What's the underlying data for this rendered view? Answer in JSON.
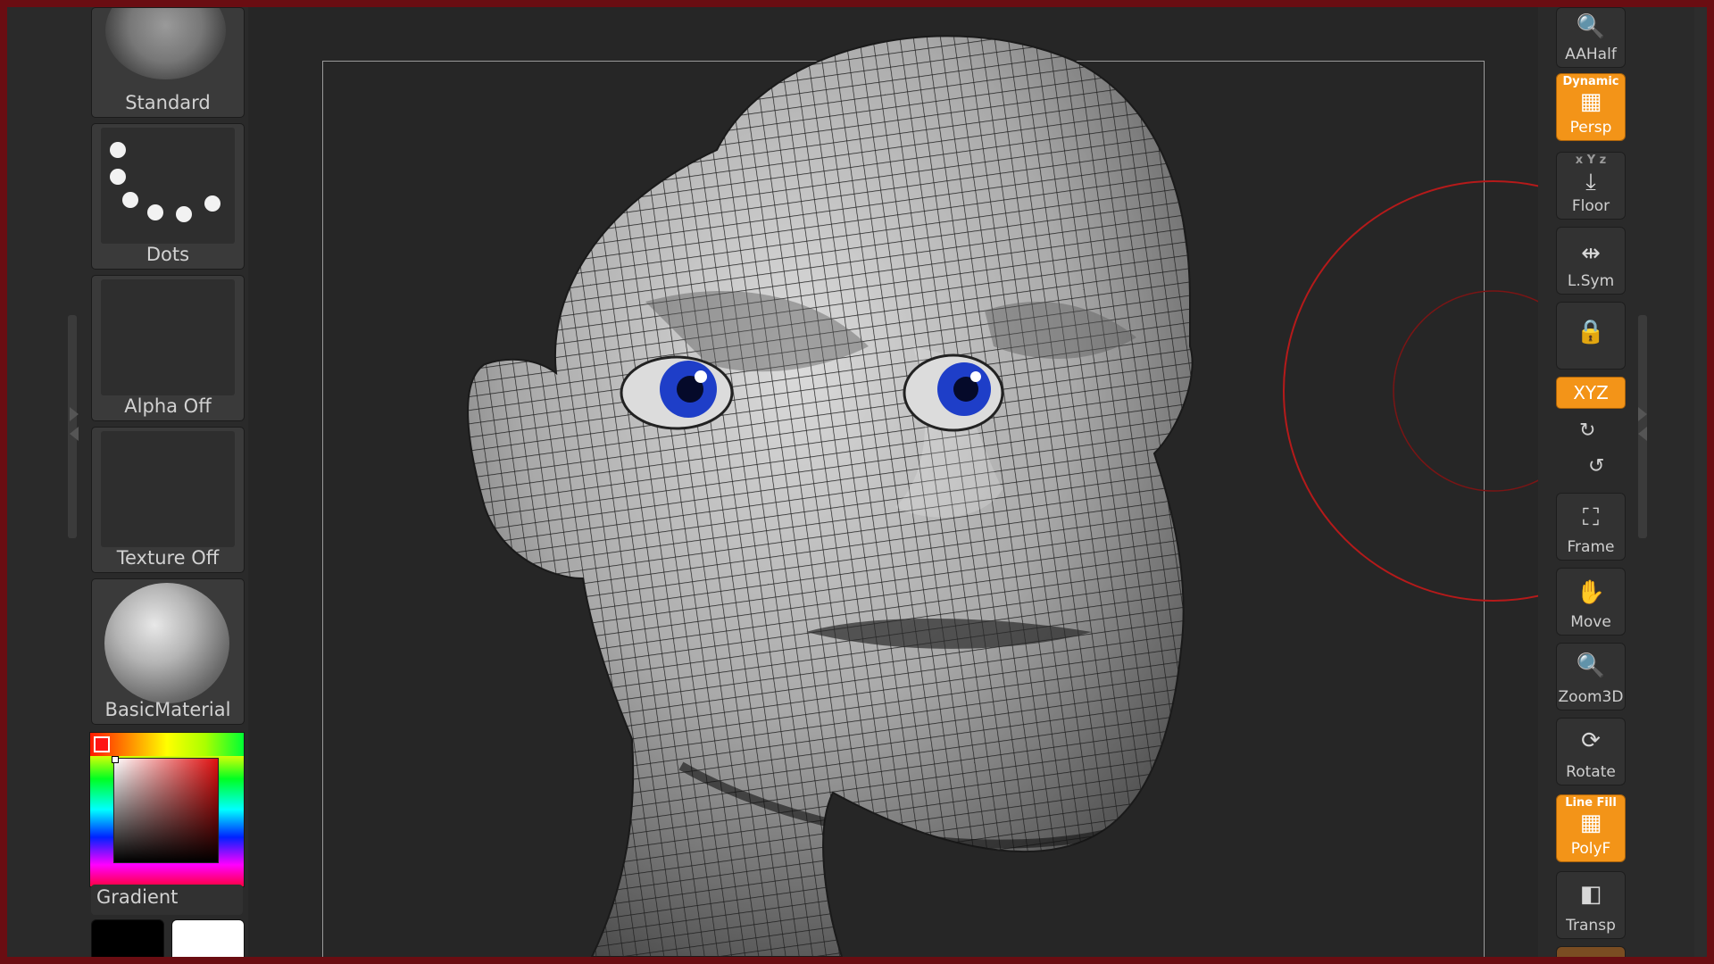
{
  "left_shelf": {
    "brush": {
      "label": "Standard"
    },
    "stroke": {
      "label": "Dots"
    },
    "alpha": {
      "label": "Alpha Off"
    },
    "texture": {
      "label": "Texture Off"
    },
    "material": {
      "label": "BasicMaterial"
    },
    "color": {
      "primary": "#ff1414",
      "gradient_label": "Gradient",
      "main_swatch": "#000000",
      "secondary_swatch": "#ffffff"
    }
  },
  "right_shelf": {
    "buttons": [
      {
        "label": "AAHalf",
        "icon": "magnifier-icon",
        "active": false
      },
      {
        "label": "Persp",
        "tag": "Dynamic",
        "icon": "perspective-grid-icon",
        "active": true
      },
      {
        "label": "Floor",
        "tag": "x Y z",
        "icon": "floor-icon",
        "active": false
      },
      {
        "label": "L.Sym",
        "icon": "local-symmetry-icon",
        "active": false
      },
      {
        "label": "",
        "icon": "lock-camera-icon",
        "active": false
      },
      {
        "label": "XYZ",
        "icon": "rotate-xyz-icon",
        "active": true
      },
      {
        "label": "Frame",
        "icon": "frame-icon",
        "active": false
      },
      {
        "label": "Move",
        "icon": "hand-move-icon",
        "active": false
      },
      {
        "label": "Zoom3D",
        "icon": "zoom3d-icon",
        "active": false
      },
      {
        "label": "Rotate",
        "icon": "rotate-icon",
        "active": false
      },
      {
        "label": "PolyF",
        "tag": "Line Fill",
        "icon": "polyframe-icon",
        "active": true
      },
      {
        "label": "Transp",
        "icon": "transparency-icon",
        "active": false
      }
    ]
  },
  "colors": {
    "accent": "#f39418",
    "frame_border": "#6a0d12",
    "panel": "#2a2a2a",
    "canvas": "#262626",
    "gizmo": "#b51a1a",
    "eye_iris": "#1e3ec8"
  }
}
